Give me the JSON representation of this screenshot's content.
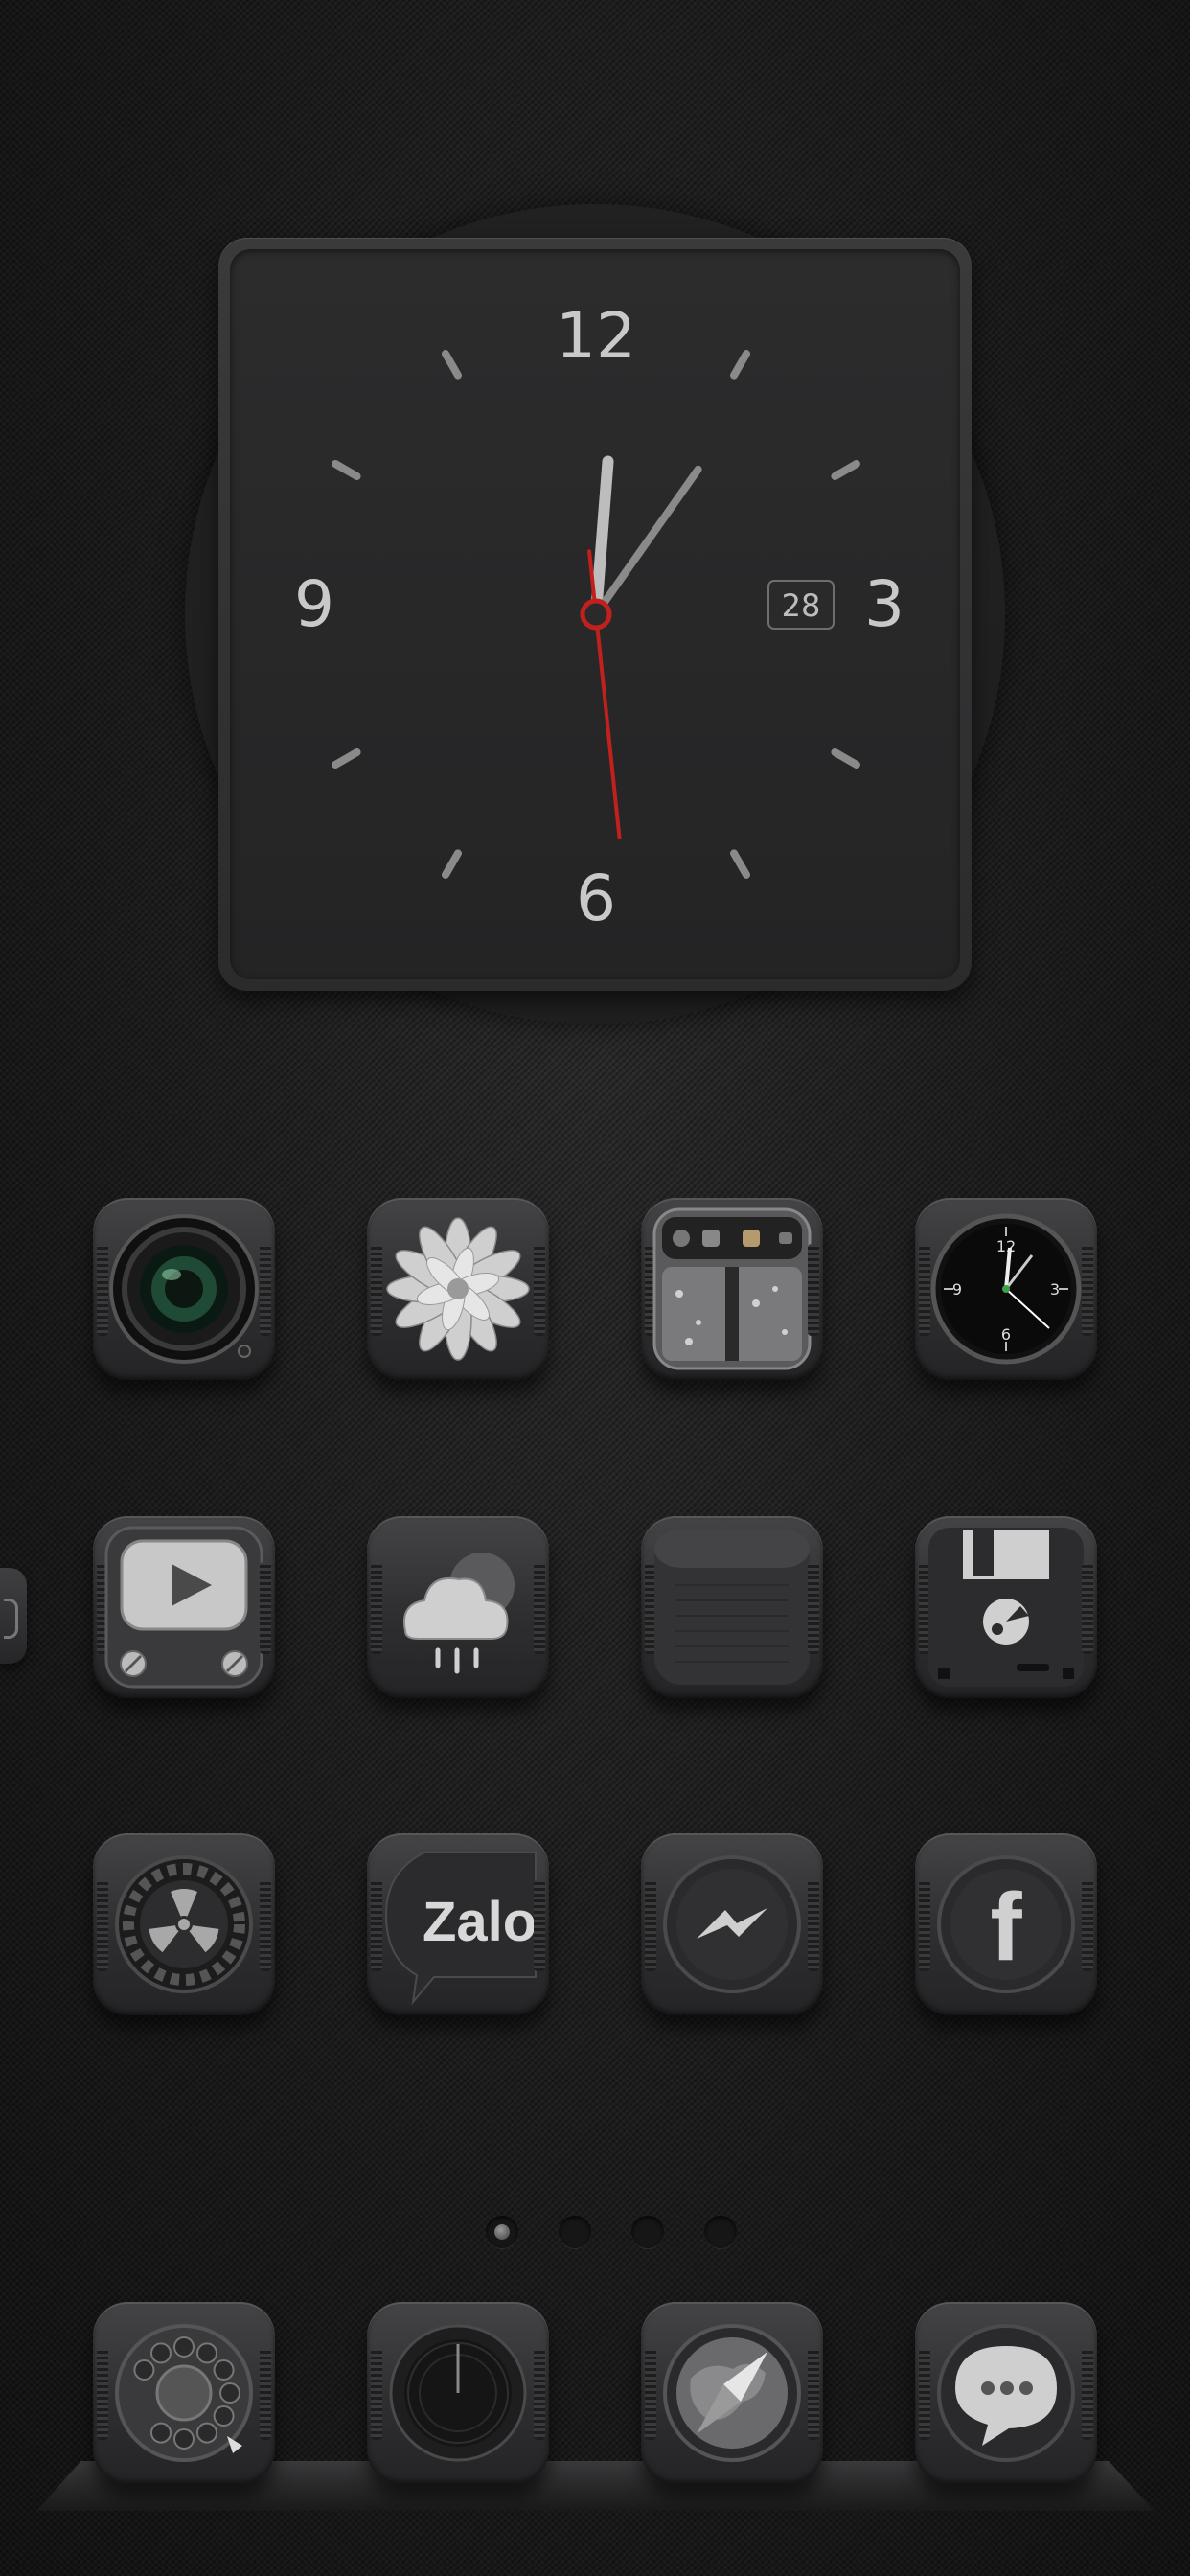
{
  "clock_widget": {
    "numerals": {
      "twelve": "12",
      "three": "3",
      "six": "6",
      "nine": "9"
    },
    "date": "28",
    "time": {
      "hour": 12,
      "minute": 1,
      "second": 22
    },
    "hand_colors": {
      "hour": "#bdbdbd",
      "minute": "#8a8a8a",
      "second": "#c0211d"
    }
  },
  "home_icons": [
    {
      "row": 1,
      "icons": [
        "camera-icon",
        "photos-flower-icon",
        "app-library-icon",
        "clock-app-icon"
      ]
    },
    {
      "row": 2,
      "icons": [
        "youtube-tv-icon",
        "weather-rain-cloud-icon",
        "notes-icon",
        "floppy-disk-save-icon"
      ]
    },
    {
      "row": 3,
      "icons": [
        "settings-gear-radiation-icon",
        "zalo-chat-icon",
        "messenger-bolt-icon",
        "facebook-icon"
      ]
    }
  ],
  "zalo_label": "Zalo",
  "facebook_letter": "f",
  "page_indicator": {
    "count": 4,
    "active_index": 0
  },
  "dock": [
    "rotary-phone-icon",
    "volume-knob-icon",
    "safari-compass-icon",
    "messages-bubble-icon"
  ],
  "colors": {
    "background": "#1b1b1c",
    "accent_red": "#c0211d",
    "icon_grey": "#d0d0d0"
  }
}
